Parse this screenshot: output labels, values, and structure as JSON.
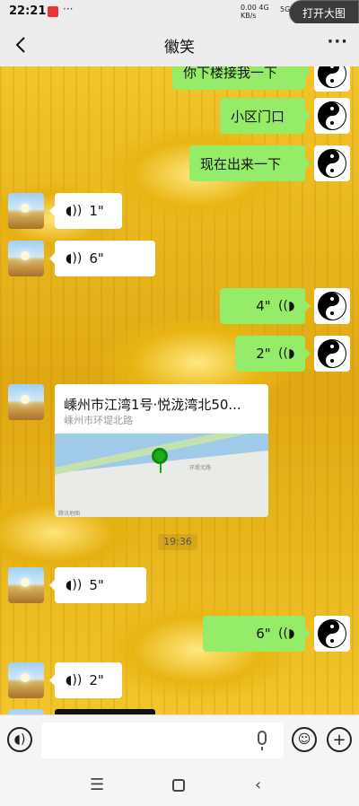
{
  "status_bar": {
    "time": "22:21",
    "dots": "···",
    "net_speed": "0.00",
    "net_unit": "KB/s",
    "net_type": "4G",
    "signal": "5G",
    "open_image_label": "打开大图"
  },
  "header": {
    "title": "徽笑",
    "back_icon": "chevron-left-icon",
    "more_icon": "more-dots-icon"
  },
  "messages": [
    {
      "side": "me",
      "type": "text",
      "text": "你下楼接我一下"
    },
    {
      "side": "me",
      "type": "text",
      "text": "小区门口"
    },
    {
      "side": "me",
      "type": "text",
      "text": "现在出来一下"
    },
    {
      "side": "other",
      "type": "voice",
      "duration": "1\""
    },
    {
      "side": "other",
      "type": "voice",
      "duration": "6\""
    },
    {
      "side": "me",
      "type": "voice",
      "duration": "4\""
    },
    {
      "side": "me",
      "type": "voice",
      "duration": "2\""
    },
    {
      "side": "other",
      "type": "location",
      "title": "嵊州市江湾1号·悦泷湾北50...",
      "address": "嵊州市环堤北路",
      "map_labels": [
        "环堤北路",
        "腾讯地图"
      ]
    },
    {
      "side": "other",
      "type": "voice",
      "duration": "5\""
    },
    {
      "side": "me",
      "type": "voice",
      "duration": "6\""
    },
    {
      "side": "other",
      "type": "voice",
      "duration": "2\""
    }
  ],
  "timestamp": "19:36",
  "input_bar": {
    "voice_toggle_icon": "voice-mode-icon",
    "mic_icon": "microphone-icon",
    "emoji_icon": "emoji-icon",
    "plus_icon": "plus-icon"
  },
  "nav_bar": {
    "menu_icon": "menu-icon",
    "home_icon": "home-icon",
    "back_icon": "back-icon"
  },
  "colors": {
    "my_bubble": "#95ec69",
    "other_bubble": "#ffffff",
    "chat_background": "#e8b514"
  }
}
